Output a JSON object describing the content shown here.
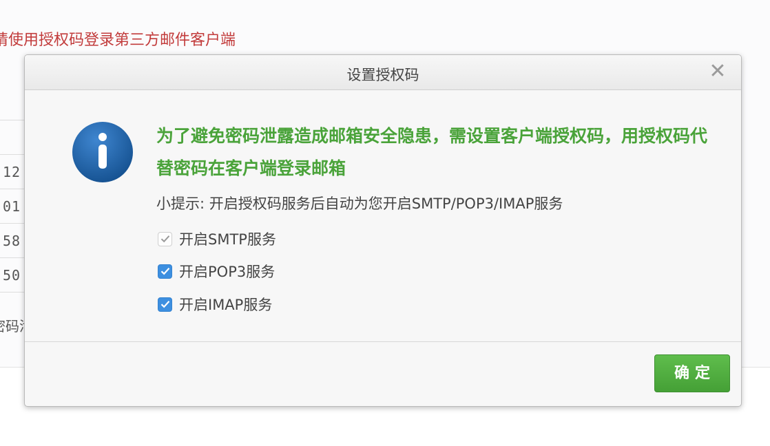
{
  "background": {
    "notice": "请使用授权码登录第三方邮件客户端",
    "table_cells": [
      "12",
      "01",
      "58",
      "50"
    ],
    "partial_text": "密码泄"
  },
  "dialog": {
    "title": "设置授权码",
    "close_symbol": "✕",
    "headline": "为了避免密码泄露造成邮箱安全隐患，需设置客户端授权码，用授权码代替密码在客户端登录邮箱",
    "tip": "小提示: 开启授权码服务后自动为您开启SMTP/POP3/IMAP服务",
    "options": [
      {
        "label": "开启SMTP服务",
        "checked": true,
        "disabled": true
      },
      {
        "label": "开启POP3服务",
        "checked": true,
        "disabled": false
      },
      {
        "label": "开启IMAP服务",
        "checked": true,
        "disabled": false
      }
    ],
    "confirm_label": "确定"
  },
  "colors": {
    "headline": "#4aa33a",
    "notice": "#c23b3b",
    "checkbox": "#3d8fe0",
    "confirm_button": "#4fae3f",
    "info_icon": "#1f62a8"
  },
  "icons": {
    "info": "info-icon",
    "close": "close-icon",
    "check": "checkmark-icon"
  }
}
